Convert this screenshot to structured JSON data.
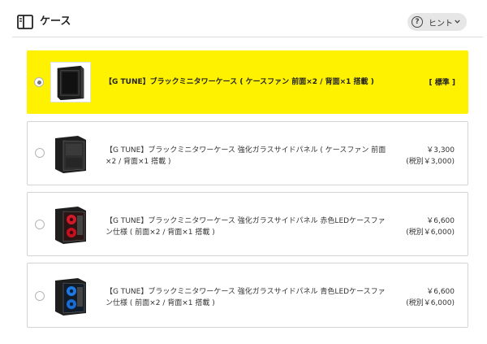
{
  "header": {
    "title": "ケース",
    "hint_label": "ヒント",
    "hint_icon_glyph": "?",
    "icons": {
      "section": "book-panel-icon",
      "hint": "question-circle-icon",
      "chevron": "chevron-down-icon"
    }
  },
  "colors": {
    "selected_bg": "#fff200",
    "border": "#d4d4d4",
    "hint_bg": "#e6e6e6"
  },
  "options": [
    {
      "name": "【G TUNE】ブラックミニタワーケース ( ケースファン 前面×2 / 背面×1 搭載 )",
      "tag": "[ 標準 ]",
      "selected": true
    },
    {
      "name_line1": "【G TUNE】ブラックミニタワーケース 強化ガラスサイドパネル ( ケースファン 前面",
      "name_line2": "×2 / 背面×1 搭載 )",
      "price": "￥3,300",
      "price_ex_tax": "(税別￥3,000)",
      "selected": false
    },
    {
      "name_line1": "【G TUNE】ブラックミニタワーケース 強化ガラスサイドパネル 赤色LEDケースファ",
      "name_line2": "ン仕様 ( 前面×2 / 背面×1 搭載 )",
      "price": "￥6,600",
      "price_ex_tax": "(税別￥6,000)",
      "selected": false
    },
    {
      "name_line1": "【G TUNE】ブラックミニタワーケース 強化ガラスサイドパネル 青色LEDケースファ",
      "name_line2": "ン仕様 ( 前面×2 / 背面×1 搭載 )",
      "price": "￥6,600",
      "price_ex_tax": "(税別￥6,000)",
      "selected": false
    }
  ]
}
